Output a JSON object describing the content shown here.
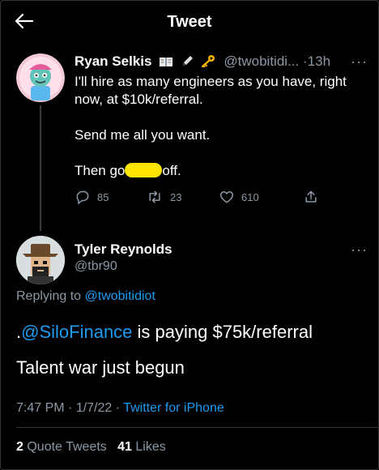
{
  "header": {
    "title": "Tweet"
  },
  "parent_tweet": {
    "author_name": "Ryan Selkis",
    "badges": [
      "book-emoji",
      "pen-emoji",
      "key-emoji"
    ],
    "handle": "@twobitidi...",
    "separator": "·",
    "time": "13h",
    "more": "···",
    "lines": {
      "l1": "I'll hire as many engineers as you have, right",
      "l2": "now, at $10k/referral.",
      "l3": "Send me all you want.",
      "l4a": "Then go",
      "l4b": "off."
    },
    "actions": {
      "replies": "85",
      "retweets": "23",
      "likes": "610"
    }
  },
  "main_tweet": {
    "author_name": "Tyler Reynolds",
    "handle": "@tbr90",
    "more": "···",
    "replying_prefix": "Replying to",
    "replying_handle": "@twobitidiot",
    "text": {
      "line1_prefix": ".",
      "mention": "@SiloFinance",
      "line1_suffix": " is paying $75k/referral",
      "line2": "Talent war just begun"
    },
    "meta": {
      "time": "7:47 PM",
      "sep1": " · ",
      "date": "1/7/22",
      "sep2": " · ",
      "source": "Twitter for iPhone"
    },
    "stats": {
      "quote_count": "2",
      "quote_label": "Quote Tweets",
      "like_count": "41",
      "like_label": "Likes"
    }
  },
  "colors": {
    "background": "#000000",
    "text": "#ffffff",
    "muted": "#8b98a5",
    "link": "#1d9bf0",
    "redaction": "#fde500"
  }
}
